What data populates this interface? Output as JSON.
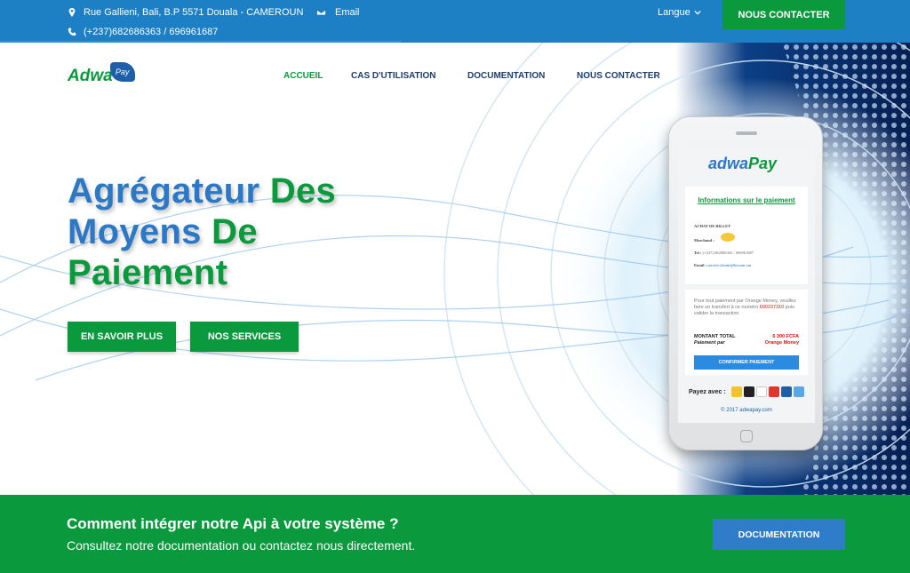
{
  "topbar": {
    "address": "Rue Gallieni, Bali, B.P 5571 Douala - CAMEROUN",
    "email_label": "Email",
    "phone": "(+237)682686363 / 696961687",
    "language_label": "Langue",
    "contact_cta": "NOUS CONTACTER"
  },
  "brand": {
    "logo_text": "Adwa",
    "logo_badge": "Pay"
  },
  "nav": {
    "items": [
      {
        "label": "ACCUEIL",
        "active": true
      },
      {
        "label": "CAS D'UTILISATION",
        "active": false
      },
      {
        "label": "DOCUMENTATION",
        "active": false
      },
      {
        "label": "NOUS CONTACTER",
        "active": false
      }
    ]
  },
  "hero": {
    "title_w1": "Agrégateur",
    "title_w2": "Des",
    "title_w3": "Moyens",
    "title_w4": "De",
    "title_w5": "Paiement",
    "btn_learn_more": "EN SAVOIR PLUS",
    "btn_services": "NOS SERVICES"
  },
  "phone": {
    "logo_a": "adwa",
    "logo_p": "Pay",
    "card_title": "Informations sur le paiement",
    "ticket_label": "ACHAT DE BILLET",
    "merchant_label": "Marchand :",
    "tel_label": "Tel :",
    "tel_value": "(+237) 682686363 / 696961687",
    "email_label": "Email :",
    "email_value": "service.clients@kiwoni.cm",
    "message_pre": "Pour tout paiement par Orange Money, veuillez faire un transfert à ce numéro",
    "message_number": "690237310",
    "message_post": "puis valider la transaction",
    "amount_label": "MONTANT TOTAL",
    "paid_by_label": "Paiement par",
    "amount_value": "6 300 FCFA",
    "amount_method": "Orange Money",
    "confirm_label": "CONFIRMER PAIEMENT",
    "pay_with_label": "Payez avec :",
    "copyright": "© 2017 adwapay.com"
  },
  "band": {
    "title": "Comment intégrer notre Api à votre système ?",
    "subtitle": "Consultez notre documentation ou contactez nous directement.",
    "button": "DOCUMENTATION"
  },
  "colors": {
    "primary_blue": "#1d7fc4",
    "brand_green": "#0a9a3d",
    "title_blue": "#2b79c6"
  },
  "icons": [
    "map-marker-icon",
    "envelope-icon",
    "phone-icon",
    "chevron-down-icon"
  ]
}
